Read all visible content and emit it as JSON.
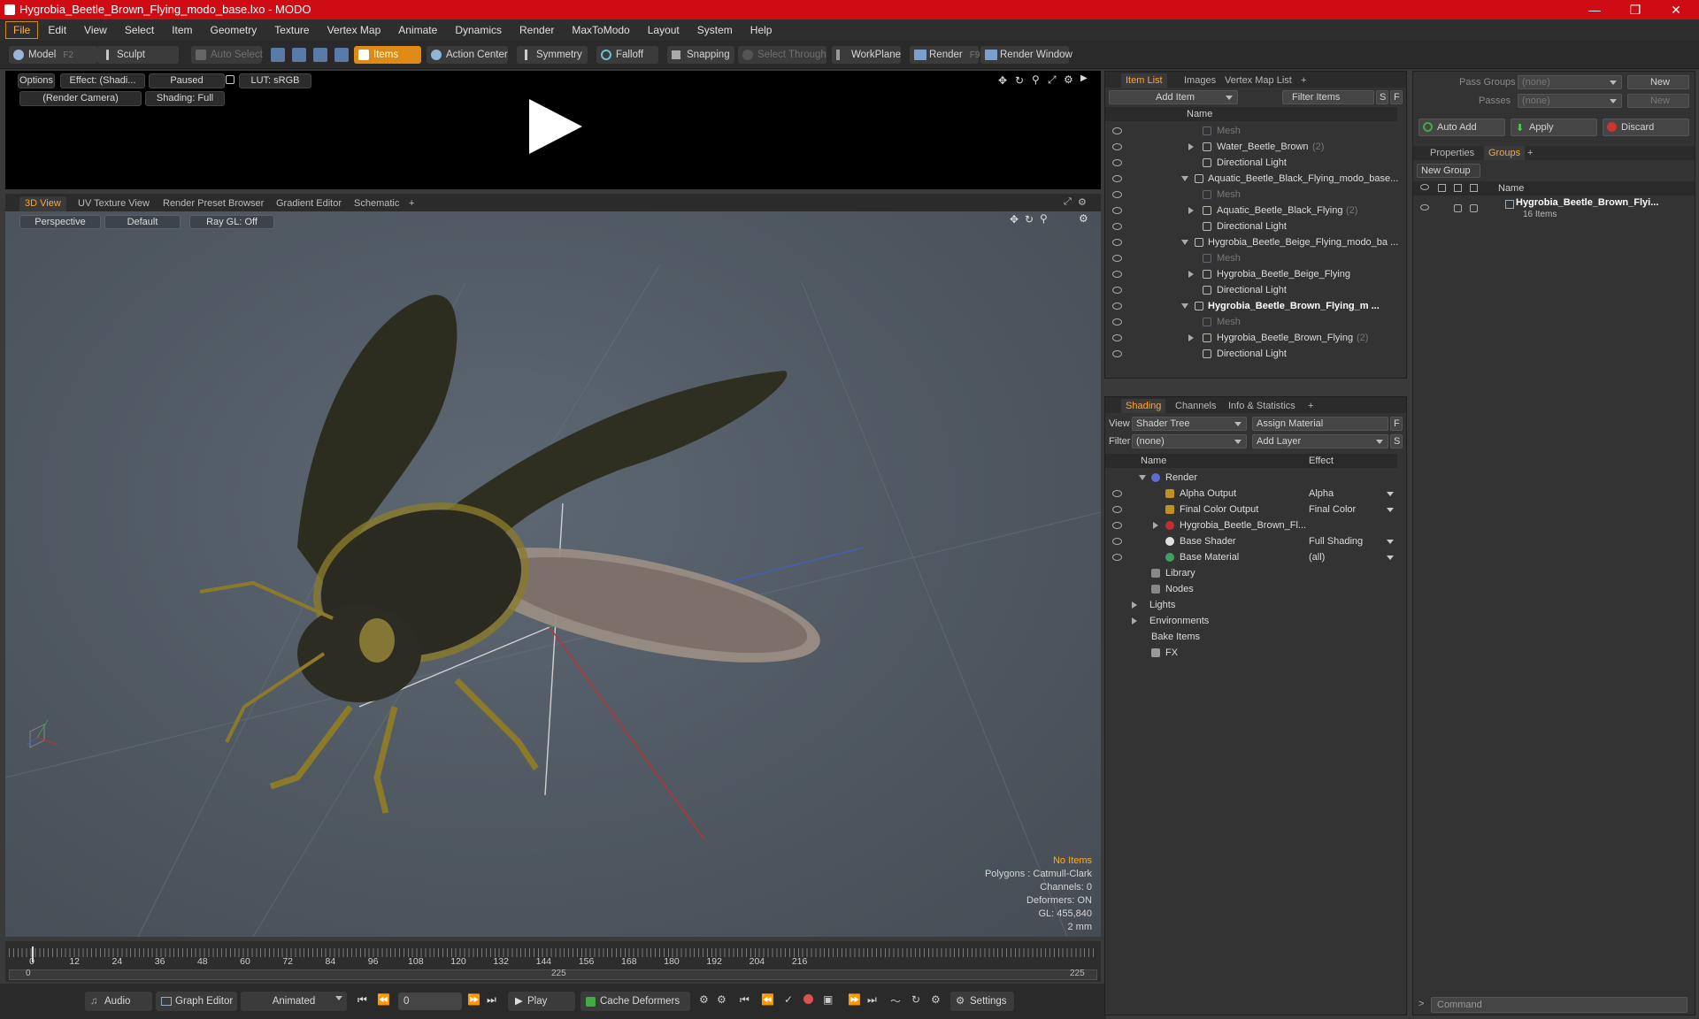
{
  "window": {
    "title": "Hygrobia_Beetle_Brown_Flying_modo_base.lxo - MODO",
    "minimize": "—",
    "restore": "❐",
    "close": "✕"
  },
  "menu": [
    "File",
    "Edit",
    "View",
    "Select",
    "Item",
    "Geometry",
    "Texture",
    "Vertex Map",
    "Animate",
    "Dynamics",
    "Render",
    "MaxToModo",
    "Layout",
    "System",
    "Help"
  ],
  "toolbar": {
    "model": "Model",
    "model_key": "F2",
    "sculpt": "Sculpt",
    "auto_select": "Auto Select",
    "items": "Items",
    "action_center": "Action Center",
    "symmetry": "Symmetry",
    "falloff": "Falloff",
    "snapping": "Snapping",
    "select_through": "Select Through",
    "workplane": "WorkPlane",
    "render": "Render",
    "render_key": "F9",
    "render_window": "Render Window"
  },
  "renderview": {
    "options": "Options",
    "effect": "Effect: (Shadi...",
    "paused": "Paused",
    "lut": "LUT: sRGB",
    "camera": "(Render Camera)",
    "shading": "Shading: Full"
  },
  "viewport_tabs": [
    "3D View",
    "UV Texture View",
    "Render Preset Browser",
    "Gradient Editor",
    "Schematic",
    "+"
  ],
  "viewport": {
    "perspective": "Perspective",
    "default": "Default",
    "raygl": "Ray GL: Off",
    "info": {
      "items": "No Items",
      "polygons": "Polygons : Catmull-Clark",
      "channels": "Channels: 0",
      "deformers": "Deformers: ON",
      "gl": "GL: 455,840",
      "scale": "2 mm"
    }
  },
  "timeline": {
    "ticks": [
      "0",
      "12",
      "24",
      "36",
      "48",
      "60",
      "72",
      "84",
      "96",
      "108",
      "120",
      "132",
      "144",
      "156",
      "168",
      "180",
      "192",
      "204",
      "216"
    ],
    "start": "0",
    "mid": "225",
    "end": "225"
  },
  "bottombar": {
    "audio": "Audio",
    "graph_editor": "Graph Editor",
    "animated": "Animated",
    "frame": "0",
    "play": "Play",
    "cache_deformers": "Cache Deformers",
    "settings": "Settings"
  },
  "item_list": {
    "tabs": [
      "Item List",
      "Images",
      "Vertex Map List",
      "+"
    ],
    "add_item": "Add Item",
    "filter_items": "Filter Items",
    "s": "S",
    "f": "F",
    "col_name": "Name",
    "rows": [
      {
        "label": "Mesh",
        "count": ""
      },
      {
        "label": "Water_Beetle_Brown",
        "count": "(2)"
      },
      {
        "label": "Directional Light",
        "count": ""
      },
      {
        "label": "Aquatic_Beetle_Black_Flying_modo_base...",
        "count": ""
      },
      {
        "label": "Mesh",
        "count": ""
      },
      {
        "label": "Aquatic_Beetle_Black_Flying",
        "count": "(2)"
      },
      {
        "label": "Directional Light",
        "count": ""
      },
      {
        "label": "Hygrobia_Beetle_Beige_Flying_modo_ba ...",
        "count": ""
      },
      {
        "label": "Mesh",
        "count": ""
      },
      {
        "label": "Hygrobia_Beetle_Beige_Flying",
        "count": ""
      },
      {
        "label": "Directional Light",
        "count": ""
      },
      {
        "label": "Hygrobia_Beetle_Brown_Flying_m ...",
        "count": ""
      },
      {
        "label": "Mesh",
        "count": ""
      },
      {
        "label": "Hygrobia_Beetle_Brown_Flying",
        "count": "(2)"
      },
      {
        "label": "Directional Light",
        "count": ""
      }
    ]
  },
  "shading": {
    "tabs": [
      "Shading",
      "Channels",
      "Info & Statistics",
      "+"
    ],
    "view_label": "View",
    "view_value": "Shader Tree",
    "assign_material": "Assign Material",
    "f": "F",
    "filter_label": "Filter",
    "filter_value": "(none)",
    "add_layer": "Add Layer",
    "s": "S",
    "col_name": "Name",
    "col_effect": "Effect",
    "rows": [
      {
        "label": "Render",
        "effect": ""
      },
      {
        "label": "Alpha Output",
        "effect": "Alpha"
      },
      {
        "label": "Final Color Output",
        "effect": "Final Color"
      },
      {
        "label": "Hygrobia_Beetle_Brown_Fl...",
        "effect": ""
      },
      {
        "label": "Base Shader",
        "effect": "Full Shading"
      },
      {
        "label": "Base Material",
        "effect": "(all)"
      },
      {
        "label": "Library",
        "effect": ""
      },
      {
        "label": "Nodes",
        "effect": ""
      },
      {
        "label": "Lights",
        "effect": ""
      },
      {
        "label": "Environments",
        "effect": ""
      },
      {
        "label": "Bake Items",
        "effect": ""
      },
      {
        "label": "FX",
        "effect": ""
      }
    ]
  },
  "groups": {
    "pass_groups_label": "Pass Groups",
    "pass_groups_value": "(none)",
    "new1": "New",
    "passes_label": "Passes",
    "passes_value": "(none)",
    "new2": "New",
    "auto_add": "Auto Add",
    "apply": "Apply",
    "discard": "Discard",
    "tabs": [
      "Properties",
      "Groups",
      "+"
    ],
    "new_group": "New Group",
    "col_name": "Name",
    "group_name": "Hygrobia_Beetle_Brown_Flyi...",
    "group_count": "16 Items"
  },
  "command": {
    "placeholder": "Command"
  },
  "colors": {
    "accent": "#e08a16",
    "title_bar": "#cf0b14",
    "tab_active": "#ffa534"
  }
}
